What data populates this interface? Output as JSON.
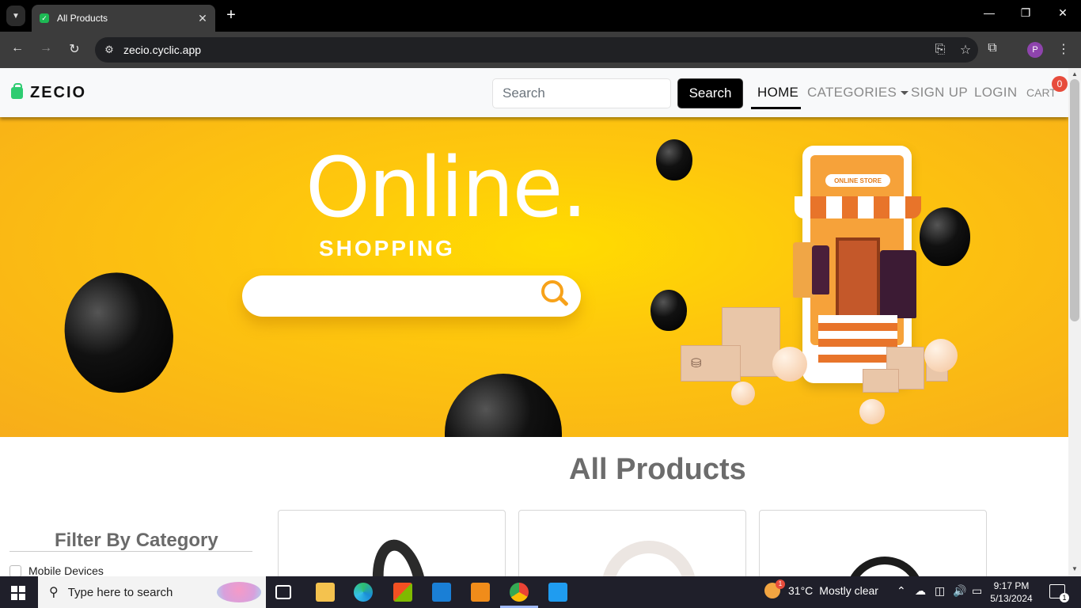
{
  "browser": {
    "tab_title": "All Products",
    "new_tab": "+",
    "url": "zecio.cyclic.app",
    "profile_initial": "P",
    "window_controls": [
      "minimize-icon",
      "restore-icon",
      "close-icon"
    ]
  },
  "site": {
    "brand": "ZECIO",
    "search_placeholder": "Search",
    "search_button": "Search",
    "nav": {
      "home": "HOME",
      "categories": "CATEGORIES",
      "signup": "SIGN UP",
      "login": "LOGIN",
      "cart": "CART",
      "cart_count": "0"
    },
    "banner": {
      "headline": "Online.",
      "subheadline": "SHOPPING",
      "store_sign": "ONLINE STORE"
    },
    "page_title": "All Products",
    "filter": {
      "title": "Filter By Category",
      "items": [
        "Mobile Devices"
      ]
    }
  },
  "taskbar": {
    "search_placeholder": "Type here to search",
    "weather_temp": "31°C",
    "weather_desc": "Mostly clear",
    "weather_alert": "1",
    "time": "9:17 PM",
    "date": "5/13/2024",
    "notification_count": "1",
    "apps": [
      "task-view-icon",
      "file-explorer-icon",
      "edge-icon",
      "store-icon",
      "mail-icon",
      "sublime-text-icon",
      "chrome-icon",
      "vscode-icon"
    ]
  },
  "colors": {
    "accent": "#1db954",
    "banner": "#fec70d",
    "badge": "#e74c3c",
    "taskbar": "#1f1f2a"
  }
}
